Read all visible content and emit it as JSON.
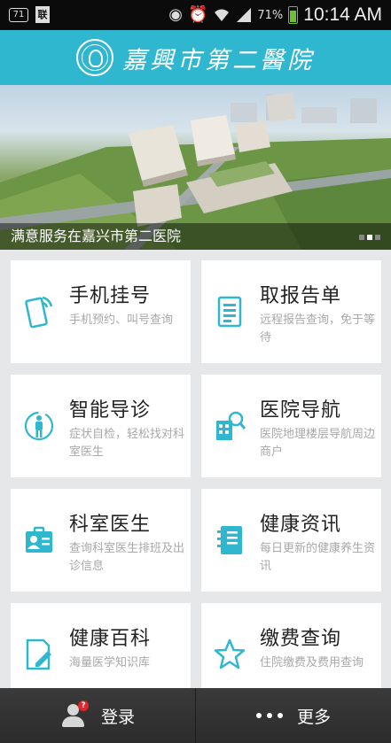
{
  "status_bar": {
    "notification_box": "71",
    "doc_icon_label": "联",
    "battery_percent": "71%",
    "time": "10:14 AM",
    "icons": [
      "eye-icon",
      "alarm-icon",
      "wifi-icon",
      "signal-icon",
      "battery-icon"
    ]
  },
  "header": {
    "title": "嘉興市第二醫院",
    "accent": "#2fb7cf"
  },
  "banner": {
    "caption": "满意服务在嘉兴市第二医院",
    "slides": 3,
    "active_slide": 1
  },
  "cards": [
    {
      "title": "手机挂号",
      "desc": "手机预约、叫号查询",
      "icon": "phone-register-icon"
    },
    {
      "title": "取报告单",
      "desc": "远程报告查询，免于等待",
      "icon": "report-document-icon"
    },
    {
      "title": "智能导诊",
      "desc": "症状自检，轻松找对科室医生",
      "icon": "body-guide-icon"
    },
    {
      "title": "医院导航",
      "desc": "医院地理楼层导航周边商户",
      "icon": "hospital-navigation-icon"
    },
    {
      "title": "科室医生",
      "desc": "查询科室医生排班及出诊信息",
      "icon": "doctor-badge-icon"
    },
    {
      "title": "健康资讯",
      "desc": "每日更新的健康养生资讯",
      "icon": "notebook-icon"
    },
    {
      "title": "健康百科",
      "desc": "海量医学知识库",
      "icon": "encyclopedia-edit-icon"
    },
    {
      "title": "缴费查询",
      "desc": "住院缴费及费用查询",
      "icon": "star-icon"
    }
  ],
  "bottom_bar": {
    "login_label": "登录",
    "login_badge": "?",
    "more_label": "更多"
  }
}
